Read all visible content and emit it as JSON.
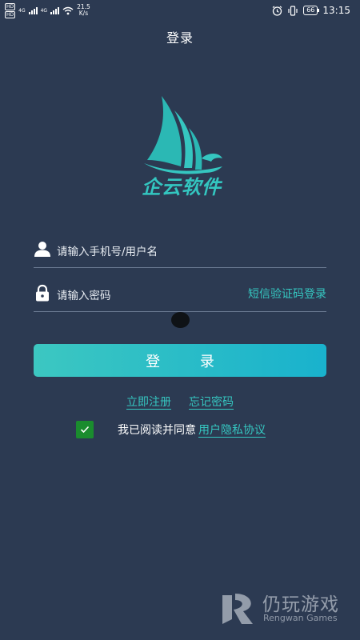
{
  "status_bar": {
    "hd": "HD",
    "network_1": "4G",
    "network_2": "4G",
    "speed_value": "21.5",
    "speed_unit": "K/s",
    "battery": "66",
    "time": "13:15"
  },
  "header": {
    "title": "登录"
  },
  "logo": {
    "brand_name": "企云软件"
  },
  "form": {
    "username_placeholder": "请输入手机号/用户名",
    "password_placeholder": "请输入密码",
    "sms_login_link": "短信验证码登录",
    "login_button": "登 录"
  },
  "links": {
    "register": "立即注册",
    "forgot_password": "忘记密码"
  },
  "agreement": {
    "checked": true,
    "text": "我已阅读并同意",
    "policy_link": "用户隐私协议"
  },
  "watermark": {
    "name": "仍玩游戏",
    "sub": "Rengwan Games"
  },
  "colors": {
    "background": "#2c3a52",
    "accent": "#35c6c0",
    "button_start": "#3cc7c1",
    "button_end": "#19b2cd",
    "checkbox": "#1a8c2e"
  }
}
